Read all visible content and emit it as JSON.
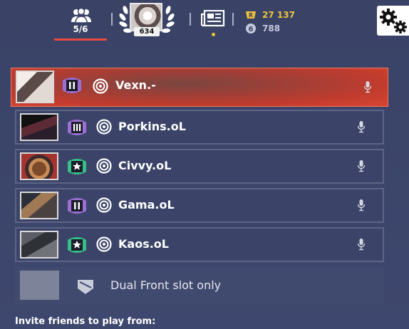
{
  "party": {
    "count": "5/6"
  },
  "profile": {
    "level": "634"
  },
  "currency": {
    "renown": "27 137",
    "credits": "788"
  },
  "party_members": [
    {
      "name": "Vexn.-",
      "leader": true,
      "rank_icon": "rank-ii-icon",
      "avatar": "manga-portrait"
    },
    {
      "name": "Porkins.oL",
      "leader": false,
      "rank_icon": "rank-iii-icon",
      "avatar": "dark-warrior"
    },
    {
      "name": "Civvy.oL",
      "leader": false,
      "rank_icon": "rank-star-icon",
      "avatar": "cartoon-bear"
    },
    {
      "name": "Gama.oL",
      "leader": false,
      "rank_icon": "rank-ii-icon",
      "avatar": "soldier"
    },
    {
      "name": "Kaos.oL",
      "leader": false,
      "rank_icon": "rank-star-icon",
      "avatar": "armored-operator"
    }
  ],
  "empty_slot": {
    "label": "Dual Front slot only"
  },
  "invite": {
    "label": "Invite friends to play from:"
  },
  "colors": {
    "accent": "#e84a3c",
    "renown": "#f0c33a",
    "leader_bg": "#c13c2e",
    "panel": "#3b4468"
  }
}
